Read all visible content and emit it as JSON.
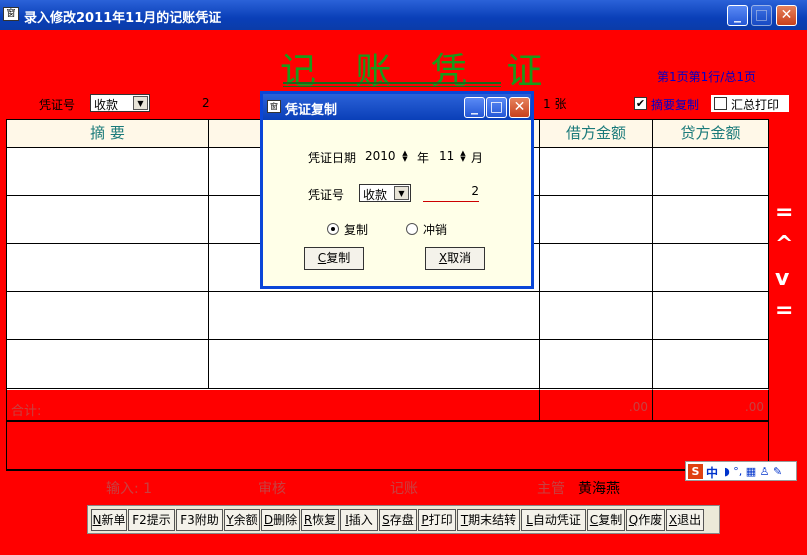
{
  "window": {
    "title": "录入修改2011年11月的记账凭证",
    "app_icon": "窗",
    "min_glyph": "_",
    "max_glyph": "□",
    "close_glyph": "✕"
  },
  "header": {
    "big_title": "记 账 凭 证",
    "page_info": "第1页第1行/总1页"
  },
  "voucher_row": {
    "voucher_no_label": "凭证号",
    "voucher_type": "收款",
    "voucher_number": "2",
    "attachments_suffix": "1 张",
    "summary_copy_label": "摘要复制",
    "summary_copy_checked": "✔",
    "summary_print_label": "汇总打印"
  },
  "grid": {
    "headers": [
      "摘    要",
      "",
      "",
      "借方金额",
      "贷方金额"
    ],
    "total_label": "合计:",
    "total_debit": ".00",
    "total_credit": ".00"
  },
  "side": {
    "top": "=",
    "up": "^",
    "down": "v",
    "bottom": "="
  },
  "footer": {
    "input_label": "输入: 1",
    "review_label": "审核",
    "post_label": "记账",
    "supervisor_label": "主管",
    "supervisor_name": "黄海燕"
  },
  "toolbar": [
    {
      "key": "N",
      "text": "新单"
    },
    {
      "key": "F2",
      "text": "提示"
    },
    {
      "key": "F3",
      "text": "附助"
    },
    {
      "key": "Y",
      "text": "余额"
    },
    {
      "key": "D",
      "text": "删除"
    },
    {
      "key": "R",
      "text": "恢复"
    },
    {
      "key": "I",
      "text": "插入"
    },
    {
      "key": "S",
      "text": "存盘"
    },
    {
      "key": "P",
      "text": "打印"
    },
    {
      "key": "T",
      "text": "期末结转"
    },
    {
      "key": "L",
      "text": "自动凭证"
    },
    {
      "key": "C",
      "text": "复制"
    },
    {
      "key": "Q",
      "text": "作废"
    },
    {
      "key": "X",
      "text": "退出"
    }
  ],
  "ime": {
    "logo": "S",
    "mode": "中",
    "icons": "◗ °, ▦ ♙ ✎"
  },
  "dialog": {
    "title": "凭证复制",
    "date_label": "凭证日期",
    "year": "2010",
    "year_suffix": "年",
    "month": "11",
    "month_suffix": "月",
    "voucher_no_label": "凭证号",
    "voucher_type": "收款",
    "voucher_number": "2",
    "radio_copy": "复制",
    "radio_reverse": "冲销",
    "ok_key": "C",
    "ok_text": "复制",
    "cancel_key": "X",
    "cancel_text": "取消",
    "spin_up": "▲",
    "spin_down": "▼",
    "dropdown": "▼"
  },
  "colors": {
    "background": "#ff0000",
    "title_green": "#1a9a1a",
    "header_teal": "#1a7a7a",
    "page_info_blue": "#0000cc",
    "titlebar_blue": "#0a3fb8"
  }
}
